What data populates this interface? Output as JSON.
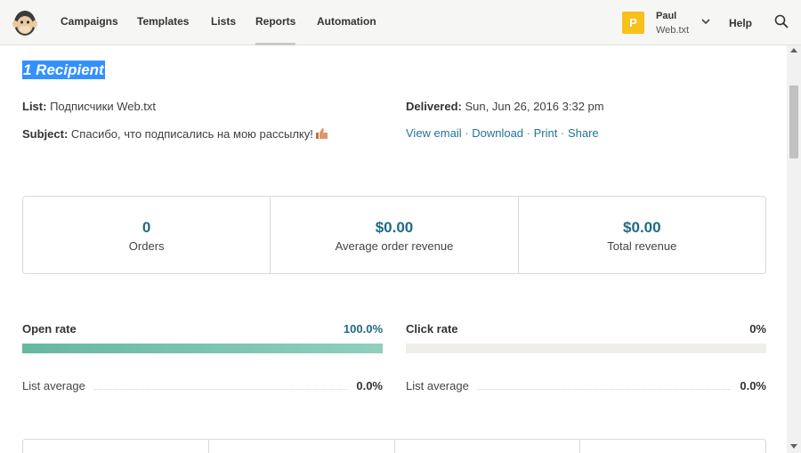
{
  "nav": {
    "logo_icon": "mailchimp-logo-icon",
    "items": [
      {
        "label": "Campaigns"
      },
      {
        "label": "Templates"
      },
      {
        "label": "Lists"
      },
      {
        "label": "Reports"
      },
      {
        "label": "Automation"
      }
    ],
    "active": "Reports",
    "user": {
      "initial": "P",
      "name": "Paul",
      "org": "Web.txt",
      "avatar_color": "#f7c01b"
    },
    "help_label": "Help",
    "search_icon": "search-icon"
  },
  "report": {
    "recipients": "1 Recipient",
    "list_label": "List:",
    "list_value": "Подписчики Web.txt",
    "subject_label": "Subject:",
    "subject_value": "Спасибо, что подписались на мою рассылку!",
    "subject_emoji": "thumbs-up-icon",
    "delivered_label": "Delivered:",
    "delivered_value": "Sun, Jun 26, 2016 3:32 pm",
    "links": [
      "View email",
      "Download",
      "Print",
      "Share"
    ],
    "link_separator": "·"
  },
  "stats": [
    {
      "value": "0",
      "label": "Orders"
    },
    {
      "value": "$0.00",
      "label": "Average order revenue"
    },
    {
      "value": "$0.00",
      "label": "Total revenue"
    }
  ],
  "rates": {
    "open": {
      "title": "Open rate",
      "value": "100.0%",
      "fill": 1.0,
      "avg_label": "List average",
      "avg_value": "0.0%",
      "color": "#1f6b85"
    },
    "click": {
      "title": "Click rate",
      "value": "0%",
      "fill": 0.0,
      "avg_label": "List average",
      "avg_value": "0.0%",
      "color": "#333333"
    }
  },
  "colors": {
    "accent": "#1f6b85",
    "link": "#247592",
    "bar": "#66b8a0",
    "selection": "#3390ff"
  }
}
